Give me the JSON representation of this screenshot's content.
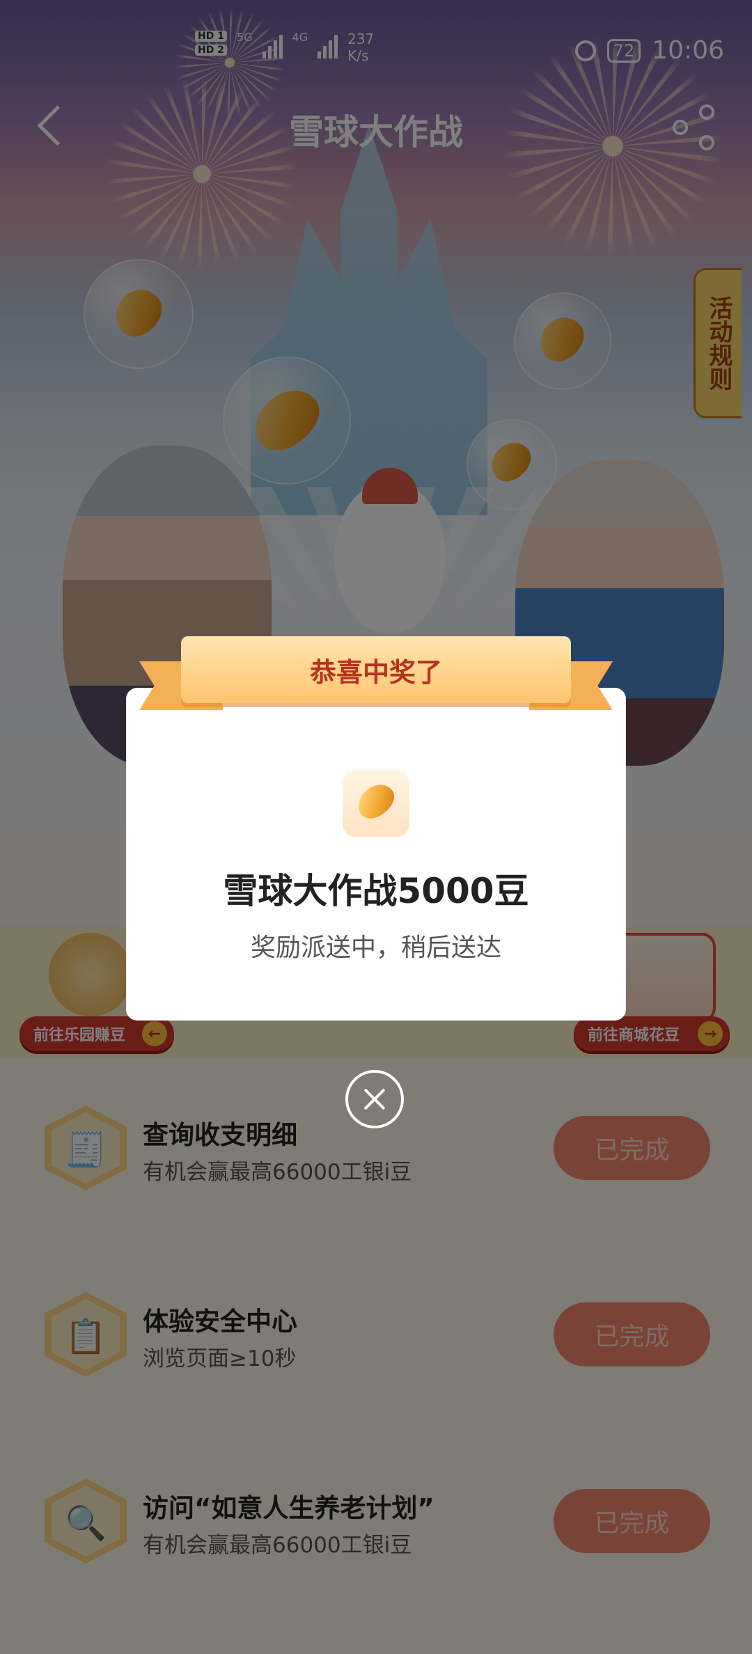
{
  "status_bar": {
    "hd1": "HD 1",
    "hd2": "HD 2",
    "net1": "5G",
    "net2": "4G",
    "speed_value": "237",
    "speed_unit": "K/s",
    "battery": "72",
    "time": "10:06"
  },
  "nav": {
    "title": "雪球大作战",
    "back_icon": "chevron-left-icon",
    "share_icon": "share-icon"
  },
  "rules_tab": {
    "label": "活动规则"
  },
  "shortcuts": {
    "left_label": "前往乐园赚豆",
    "right_label": "前往商城花豆"
  },
  "tasks": [
    {
      "title": "查询收支明细",
      "desc": "有机会赢最高66000工银i豆",
      "button": "已完成",
      "icon": "receipt-icon"
    },
    {
      "title": "体验安全中心",
      "desc": "浏览页面≥10秒",
      "button": "已完成",
      "icon": "clipboard-icon"
    },
    {
      "title": "访问“如意人生养老计划”",
      "desc": "有机会赢最高66000工银i豆",
      "button": "已完成",
      "icon": "magnifier-icon"
    }
  ],
  "modal": {
    "ribbon_text": "恭喜中奖了",
    "prize_name": "雪球大作战5000豆",
    "prize_sub": "奖励派送中，稍后送达",
    "close_icon": "close-circle-icon"
  },
  "colors": {
    "accent_red": "#d43b2e",
    "button_done": "#f48670",
    "ribbon": "#ffc46e"
  }
}
